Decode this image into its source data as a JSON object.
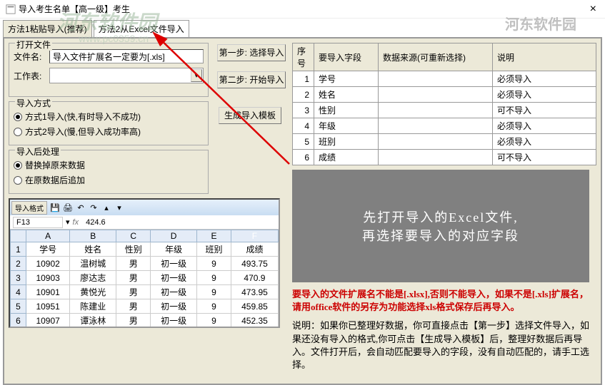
{
  "window": {
    "title": "导入考生名单【高一级】考生"
  },
  "watermark1": "河东软件园",
  "watermark2": "河东软件园",
  "pc_url": "www.pc0359.cn",
  "tabs": {
    "t1": "方法1粘贴导入(推荐)",
    "t2": "方法2从Excel文件导入"
  },
  "openFile": {
    "group": "打开文件",
    "fileLabel": "文件名:",
    "fileValue": "导入文件扩展名一定要为[.xls]",
    "sheetLabel": "工作表:"
  },
  "steps": {
    "step1": "第一步: 选择导入",
    "step2": "第二步: 开始导入",
    "template": "生成导入模板"
  },
  "importMode": {
    "group": "导入方式",
    "m1": "方式1导入(快,有时导入不成功)",
    "m2": "方式2导入(慢,但导入成功率高)"
  },
  "postProcess": {
    "group": "导入后处理",
    "p1": "替换掉原来数据",
    "p2": "在原数据后追加"
  },
  "fields": {
    "headers": {
      "seq": "序号",
      "field": "要导入字段",
      "source": "数据来源(可重新选择)",
      "note": "说明"
    },
    "rows": [
      {
        "seq": "1",
        "field": "学号",
        "note": "必须导入"
      },
      {
        "seq": "2",
        "field": "姓名",
        "note": "必须导入"
      },
      {
        "seq": "3",
        "field": "性别",
        "note": "可不导入"
      },
      {
        "seq": "4",
        "field": "年级",
        "note": "必须导入"
      },
      {
        "seq": "5",
        "field": "班别",
        "note": "必须导入"
      },
      {
        "seq": "6",
        "field": "成绩",
        "note": "可不导入"
      }
    ]
  },
  "grayPanel": {
    "line1": "先打开导入的Excel文件,",
    "line2": "再选择要导入的对应字段"
  },
  "warning": "要导入的文件扩展名不能是[.xlsx],否则不能导入，如果不是[.xls]扩展名，请用office软件的另存为功能选择xls格式保存后再导入。",
  "instruction": "说明：如果你已整理好数据，你可直接点击【第一步】选择文件导入，如果还没有导入的格式,你可点击【生成导入模板】后，整理好数据后再导入。文件打开后，会自动匹配要导入的字段，没有自动匹配的，请手工选择。",
  "excel": {
    "tbLabel": "导入格式",
    "cellRef": "F13",
    "formulaVal": "424.6",
    "cols": [
      "",
      "A",
      "B",
      "C",
      "D",
      "E",
      "F"
    ],
    "rows": [
      {
        "n": "1",
        "A": "学号",
        "B": "姓名",
        "C": "性别",
        "D": "年级",
        "E": "班别",
        "F": "成绩"
      },
      {
        "n": "2",
        "A": "10902",
        "B": "温树城",
        "C": "男",
        "D": "初一级",
        "E": "9",
        "F": "493.75"
      },
      {
        "n": "3",
        "A": "10903",
        "B": "廖达志",
        "C": "男",
        "D": "初一级",
        "E": "9",
        "F": "470.9"
      },
      {
        "n": "4",
        "A": "10901",
        "B": "黄悦光",
        "C": "男",
        "D": "初一级",
        "E": "9",
        "F": "473.95"
      },
      {
        "n": "5",
        "A": "10951",
        "B": "陈建业",
        "C": "男",
        "D": "初一级",
        "E": "9",
        "F": "459.85"
      },
      {
        "n": "6",
        "A": "10907",
        "B": "谭泳林",
        "C": "男",
        "D": "初一级",
        "E": "9",
        "F": "452.35"
      }
    ]
  }
}
